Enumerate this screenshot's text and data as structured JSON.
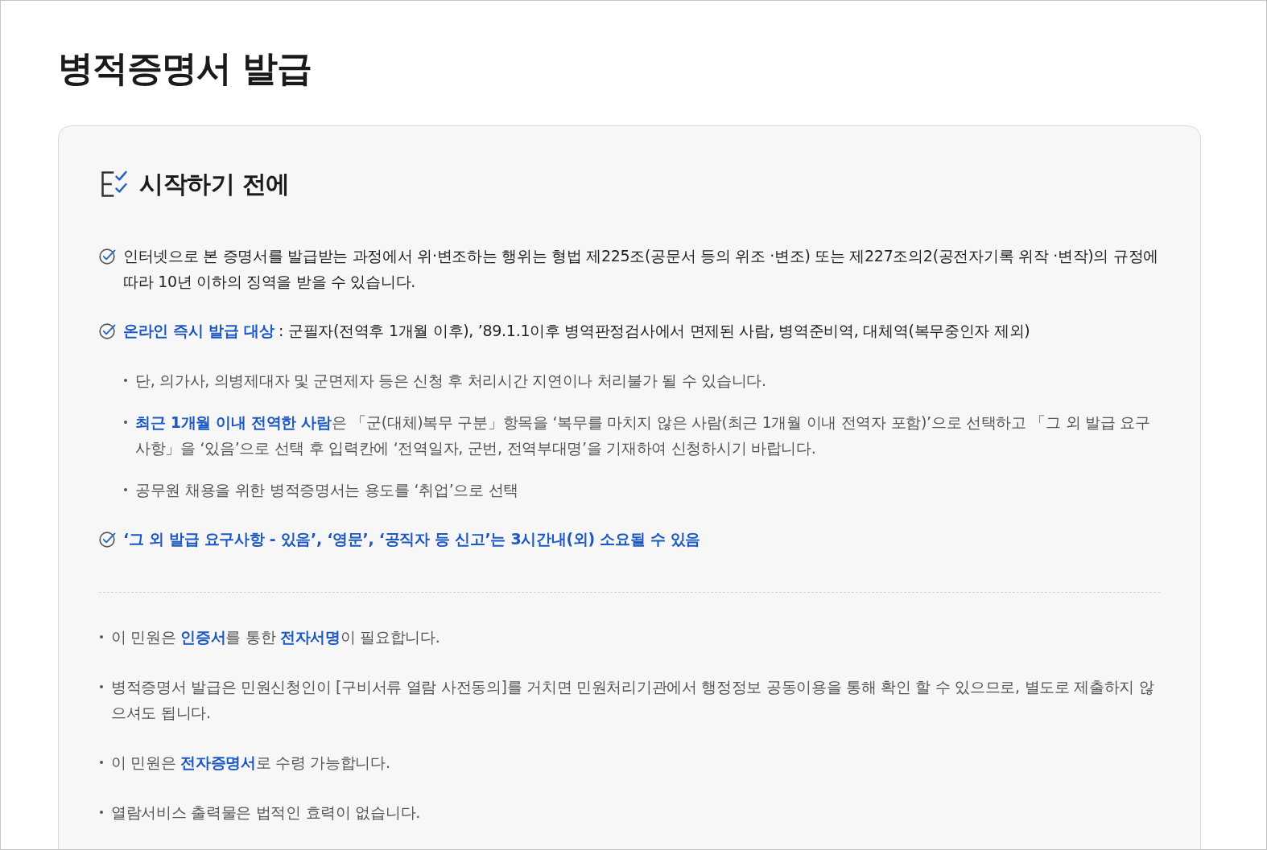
{
  "page": {
    "title": "병적증명서 발급"
  },
  "notice": {
    "heading": "시작하기 전에",
    "checklist": [
      {
        "text": "인터넷으로 본 증명서를 발급받는 과정에서 위·변조하는 행위는 형법 제225조(공문서 등의 위조 ·변조) 또는 제227조의2(공전자기록 위작 ·변작)의 규정에 따라 10년 이하의 징역을 받을 수 있습니다.",
        "emphasized": false
      },
      {
        "text": "**온라인 즉시 발급 대상** : 군필자(전역후 1개월 이후), ’89.1.1이후 병역판정검사에서 면제된 사람, 병역준비역, 대체역(복무중인자 제외)",
        "emphasized": false,
        "notes": [
          "단, 의가사, 의병제대자 및 군면제자 등은 신청 후 처리시간 지연이나 처리불가 될 수 있습니다.",
          "**최근 1개월 이내 전역한 사람**은 「군(대체)복무 구분」항목을 ‘복무를 마치지 않은 사람(최근 1개월 이내 전역자 포함)’으로 선택하고 「그 외 발급 요구사항」을 ‘있음’으로 선택 후 입력칸에 ‘전역일자, 군번, 전역부대명’을 기재하여 신청하시기 바랍니다.",
          "공무원 채용을 위한 병적증명서는 용도를 ‘취업’으로 선택"
        ]
      },
      {
        "text": "‘그 외 발급 요구사항 - 있음’, ‘영문’, ‘공직자 등 신고’는 3시간내(외) 소요될 수 있음",
        "emphasized": true
      }
    ],
    "footnotes": [
      "이 민원은 **인증서**를 통한 **전자서명**이 필요합니다.",
      "병적증명서 발급은 민원신청인이 [구비서류 열람 사전동의]를 거치면 민원처리기관에서 행정정보 공동이용을 통해 확인 할 수 있으므로, 별도로 제출하지 않으셔도 됩니다.",
      "이 민원은 **전자증명서**로 수령 가능합니다.",
      "열람서비스 출력물은 법적인 효력이 없습니다."
    ]
  }
}
